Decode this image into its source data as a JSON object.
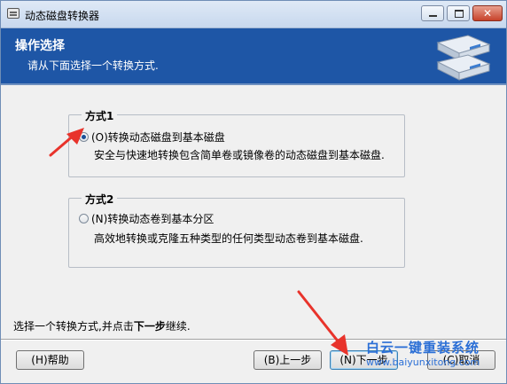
{
  "window": {
    "title": "动态磁盘转换器"
  },
  "header": {
    "title": "操作选择",
    "subtitle": "请从下面选择一个转换方式."
  },
  "options": [
    {
      "legend": "方式1",
      "label": "(O)转换动态磁盘到基本磁盘",
      "description": "安全与快速地转换包含简单卷或镜像卷的动态磁盘到基本磁盘.",
      "selected": true
    },
    {
      "legend": "方式2",
      "label": "(N)转换动态卷到基本分区",
      "description": "高效地转换或克隆五种类型的任何类型动态卷到基本磁盘.",
      "selected": false
    }
  ],
  "instruction": {
    "prefix": "选择一个转换方式,并点击",
    "emphasis": "下一步",
    "suffix": "继续."
  },
  "buttons": {
    "help": "(H)帮助",
    "back": "(B)上一步",
    "next": "(N)下一步",
    "cancel": "(C)取消"
  },
  "watermark": {
    "title": "白云一键重装系统",
    "url": "www.baiyunxitong.com"
  },
  "colors": {
    "header_bg": "#1e56a6",
    "annotation_arrow": "#e8332b",
    "watermark": "#2b6fd6"
  },
  "icons": {
    "app": "disk-converter-icon",
    "header_art": "disk-drives-icon"
  }
}
